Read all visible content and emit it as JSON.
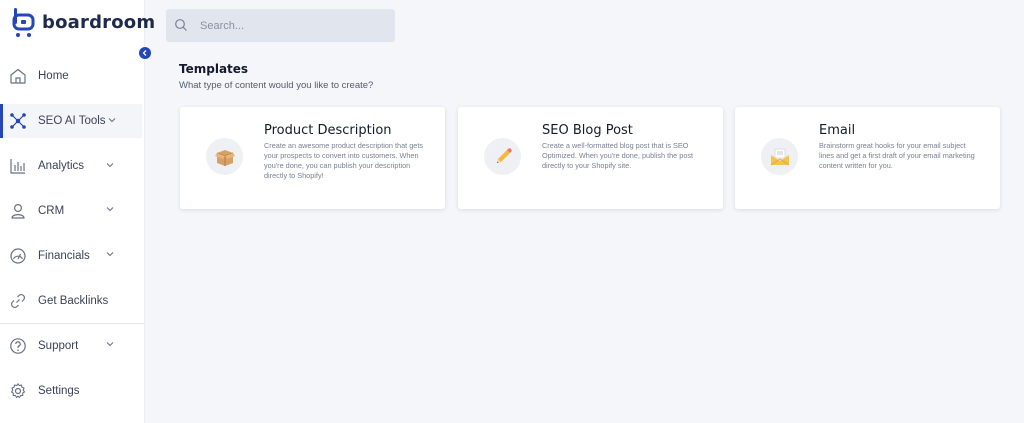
{
  "brand": {
    "name": "boardroom",
    "color": "#2346b8"
  },
  "sidebar": {
    "collapse_icon": "chevron-left-icon",
    "items": [
      {
        "label": "Home",
        "icon": "home-icon",
        "has_caret": false,
        "active": false
      },
      {
        "label": "SEO AI Tools",
        "icon": "network-icon",
        "has_caret": true,
        "active": true
      },
      {
        "label": "Analytics",
        "icon": "bar-chart-icon",
        "has_caret": true,
        "active": false
      },
      {
        "label": "CRM",
        "icon": "user-icon",
        "has_caret": true,
        "active": false
      },
      {
        "label": "Financials",
        "icon": "gauge-icon",
        "has_caret": true,
        "active": false
      },
      {
        "label": "Get Backlinks",
        "icon": "link-icon",
        "has_caret": false,
        "active": false
      },
      {
        "label": "Support",
        "icon": "help-icon",
        "has_caret": true,
        "active": false
      },
      {
        "label": "Settings",
        "icon": "gear-icon",
        "has_caret": false,
        "active": false
      }
    ]
  },
  "search": {
    "placeholder": "Search...",
    "value": ""
  },
  "templates": {
    "title": "Templates",
    "subtitle": "What type of content would you like to create?",
    "cards": [
      {
        "title": "Product Description",
        "description": "Create an awesome product description that gets your prospects to convert into customers. When you're done, you can publish your description directly to Shopify!",
        "icon": "package-icon"
      },
      {
        "title": "SEO Blog Post",
        "description": "Create a well-formatted blog post that is SEO Optimized. When you're done, publish the post directly to your Shopify site.",
        "icon": "pencil-icon"
      },
      {
        "title": "Email",
        "description": "Brainstorm great hooks for your email subject lines and get a first draft of your email marketing content written for you.",
        "icon": "envelope-icon"
      }
    ]
  }
}
